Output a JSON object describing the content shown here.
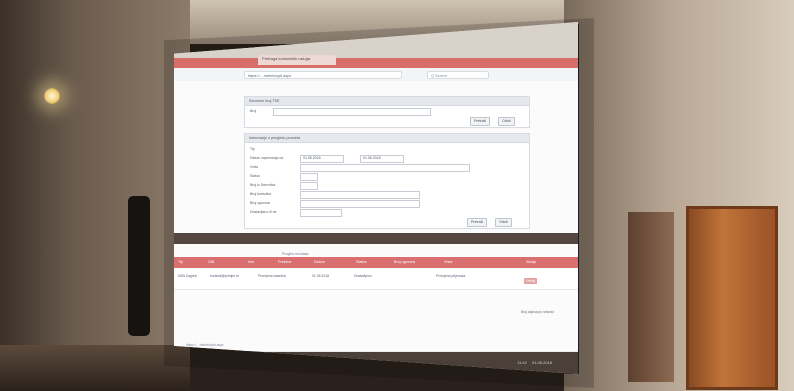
{
  "scene": {
    "browser": {
      "tab_title": "Pretraga korisničkih usluga",
      "url": "https://... /admin/upit.aspx",
      "search_placeholder": "Q Search"
    },
    "panel_top": {
      "title": "Serviceni broj TSE",
      "label": "Broj",
      "buttons": [
        "Pretraži",
        "Očisti"
      ]
    },
    "panel_filters": {
      "title": "Informacije o pregledu prometa",
      "labels": [
        "Tip",
        "Datum zaprimanja od",
        "Vrsta",
        "Status",
        "Broj iz Dnevnika",
        "Broj korisnika",
        "Broj ugovora",
        "Dostavljeno ili ne"
      ],
      "date_from": "01.05.2018",
      "date_to": "01.06.2018",
      "buttons": [
        "Pretraži",
        "Očisti"
      ]
    },
    "results": {
      "grid_title": "Pregled rezultata",
      "rows_label": "Broj zapisa po stranici",
      "columns": [
        "Tip",
        "OIB",
        "Ime",
        "Prezime",
        "Datum",
        "Status",
        "Broj ugovora",
        "Vrsta",
        "Akcija"
      ],
      "row": {
        "id": "MS5 Zagreb",
        "email": "korisnik@primjer.hr",
        "service": "Promjena vlasnika",
        "date": "01.05.2018",
        "status": "Dostavljeno",
        "note": "Promjena prijenosa",
        "action": "Detalji"
      }
    },
    "status_bar": "https://... /admin/upit.aspx",
    "taskbar": {
      "time": "11:42",
      "date": "01.06.2018"
    }
  },
  "colors": {
    "accent": "#d96f6f",
    "title_bar": "#d76f68",
    "wall_warm": "#b7a693",
    "door_wood": "#c1743a"
  }
}
